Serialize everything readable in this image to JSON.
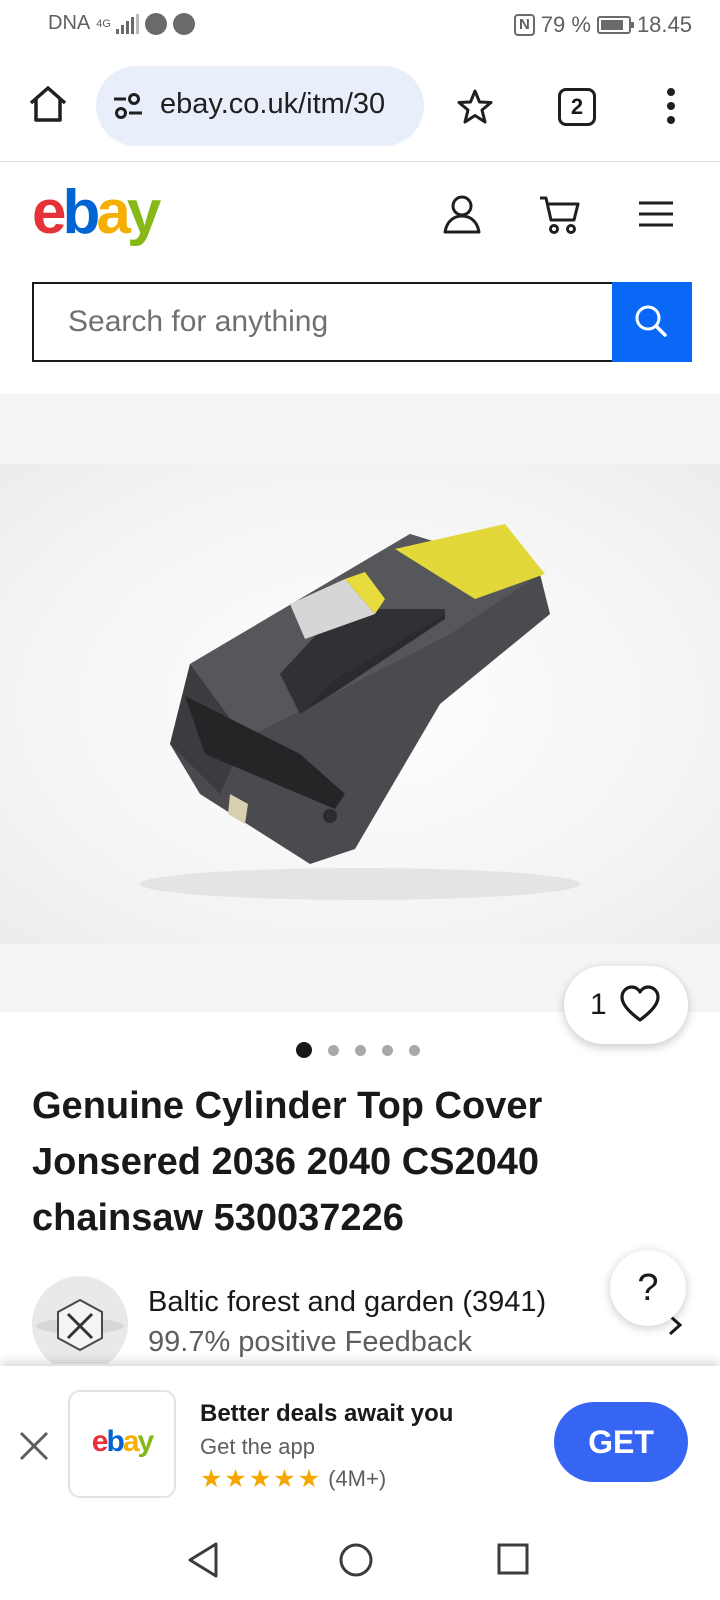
{
  "status_bar": {
    "carrier": "DNA",
    "network": "4G",
    "nfc": "N",
    "battery": "79 %",
    "time": "18.45"
  },
  "browser": {
    "url": "ebay.co.uk/itm/30",
    "tab_count": "2"
  },
  "header": {
    "logo_letters": [
      "e",
      "b",
      "a",
      "y"
    ],
    "logo_colors": [
      "#e53238",
      "#0064d2",
      "#f5af02",
      "#86b817"
    ]
  },
  "search": {
    "placeholder": "Search for anything",
    "button_color": "#0968f6"
  },
  "gallery": {
    "watch_count": "1",
    "image_count": 5,
    "active_index": 0
  },
  "product": {
    "title": "Genuine Cylinder Top Cover Jonsered 2036 2040 CS2040 chainsaw 530037226"
  },
  "help": {
    "label": "?"
  },
  "seller": {
    "name": "Baltic forest and garden (3941)",
    "feedback": "99.7% positive Feedback"
  },
  "app_banner": {
    "logo_letters": [
      "e",
      "b",
      "a",
      "y"
    ],
    "title": "Better deals await you",
    "subtitle": "Get the app",
    "rating_stars": 5,
    "reviews": "(4M+)",
    "get_label": "GET",
    "get_color": "#3665f3"
  }
}
